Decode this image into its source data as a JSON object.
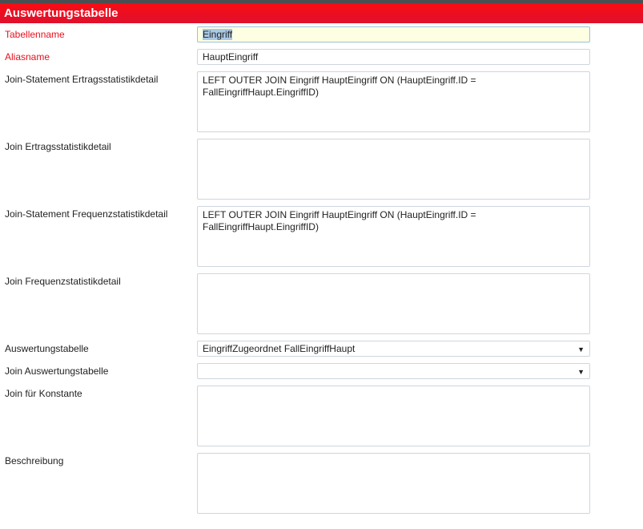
{
  "header": {
    "title": "Auswertungstabelle"
  },
  "fields": {
    "tabellenname": {
      "label": "Tabellenname",
      "value": "Eingriff"
    },
    "aliasname": {
      "label": "Aliasname",
      "value": "HauptEingriff"
    },
    "join_stmt_ertrag": {
      "label": "Join-Statement Ertragsstatistikdetail",
      "value": "LEFT OUTER JOIN Eingriff HauptEingriff  ON (HauptEingriff.ID = FallEingriffHaupt.EingriffID)"
    },
    "join_ertrag": {
      "label": "Join Ertragsstatistikdetail",
      "value": ""
    },
    "join_stmt_frequenz": {
      "label": "Join-Statement Frequenzstatistikdetail",
      "value": "LEFT OUTER JOIN Eingriff HauptEingriff  ON (HauptEingriff.ID = FallEingriffHaupt.EingriffID)"
    },
    "join_frequenz": {
      "label": "Join Frequenzstatistikdetail",
      "value": ""
    },
    "auswertungstabelle": {
      "label": "Auswertungstabelle",
      "value": "EingriffZugeordnet FallEingriffHaupt"
    },
    "join_auswertungstabelle": {
      "label": "Join Auswertungstabelle",
      "value": ""
    },
    "join_konstante": {
      "label": "Join für Konstante",
      "value": ""
    },
    "beschreibung": {
      "label": "Beschreibung",
      "value": ""
    }
  },
  "icons": {
    "dropdown": "caret-down-icon"
  }
}
